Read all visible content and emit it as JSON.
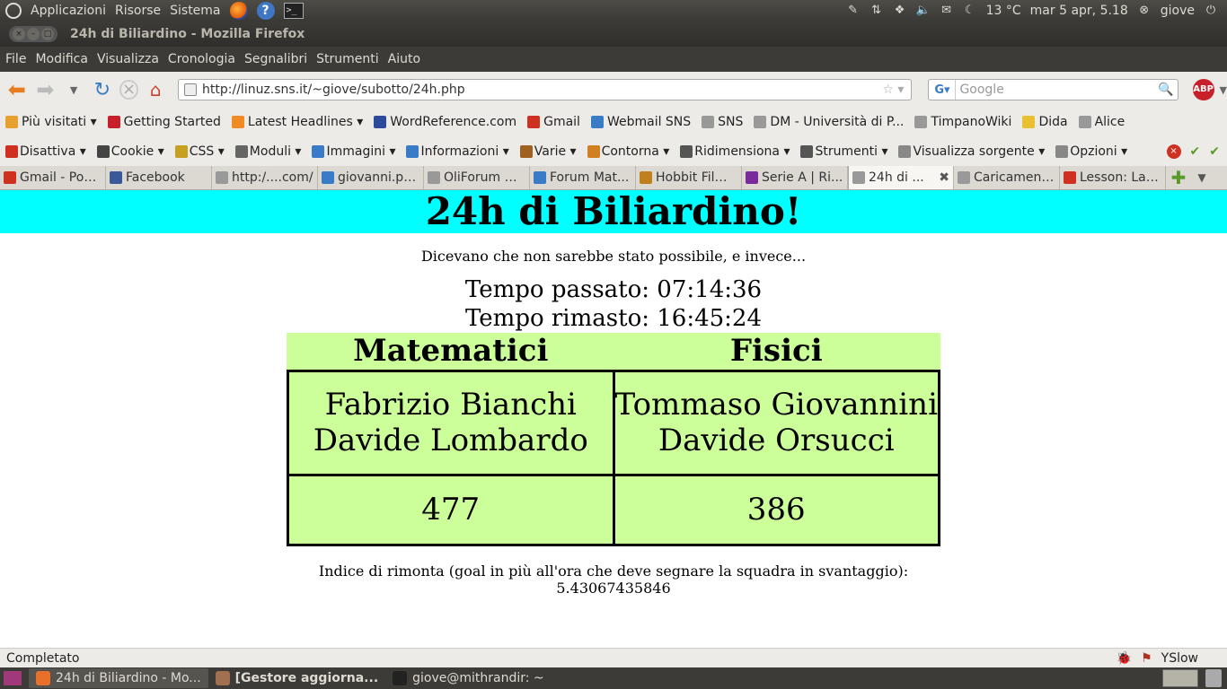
{
  "gnome_panel": {
    "menus": [
      "Applicazioni",
      "Risorse",
      "Sistema"
    ],
    "temperature": "13 °C",
    "datetime": "mar  5 apr, 5.18",
    "user": "giove"
  },
  "window": {
    "title": "24h di Biliardino - Mozilla Firefox"
  },
  "menubar": [
    "File",
    "Modifica",
    "Visualizza",
    "Cronologia",
    "Segnalibri",
    "Strumenti",
    "Aiuto"
  ],
  "navbar": {
    "url": "http://linuz.sns.it/~giove/subotto/24h.php",
    "search_placeholder": "Google",
    "abp_label": "ABP"
  },
  "bookmarks": [
    {
      "label": "Più visitati ▾",
      "color": "#e8a030"
    },
    {
      "label": "Getting Started",
      "color": "#c8202a"
    },
    {
      "label": "Latest Headlines ▾",
      "color": "#f08a24"
    },
    {
      "label": "WordReference.com",
      "color": "#2a4a9b"
    },
    {
      "label": "Gmail",
      "color": "#d03020"
    },
    {
      "label": "Webmail SNS",
      "color": "#3a7bc8"
    },
    {
      "label": "SNS",
      "color": "#999999"
    },
    {
      "label": "DM - Università di P...",
      "color": "#999999"
    },
    {
      "label": "TimpanoWiki",
      "color": "#999999"
    },
    {
      "label": "Dida",
      "color": "#e8c030"
    },
    {
      "label": "Alice",
      "color": "#999999"
    }
  ],
  "webdev": [
    {
      "label": "Disattiva ▾",
      "color": "#d03020"
    },
    {
      "label": "Cookie ▾",
      "color": "#444444"
    },
    {
      "label": "CSS ▾",
      "color": "#c8a020"
    },
    {
      "label": "Moduli ▾",
      "color": "#666666"
    },
    {
      "label": "Immagini ▾",
      "color": "#3a7bc8"
    },
    {
      "label": "Informazioni ▾",
      "color": "#3a7bc8"
    },
    {
      "label": "Varie ▾",
      "color": "#a06020"
    },
    {
      "label": "Contorna ▾",
      "color": "#d08020"
    },
    {
      "label": "Ridimensiona ▾",
      "color": "#555555"
    },
    {
      "label": "Strumenti ▾",
      "color": "#555555"
    },
    {
      "label": "Visualizza sorgente ▾",
      "color": "#888888"
    },
    {
      "label": "Opzioni ▾",
      "color": "#888888"
    }
  ],
  "tabs": [
    {
      "label": "Gmail - Pos...",
      "color": "#d03020"
    },
    {
      "label": "Facebook",
      "color": "#3b5998"
    },
    {
      "label": "http:/....com/",
      "color": "#999999"
    },
    {
      "label": "giovanni.pa...",
      "color": "#3a7bc8"
    },
    {
      "label": "OliForum M...",
      "color": "#999999"
    },
    {
      "label": "Forum Mat...",
      "color": "#3a7bc8"
    },
    {
      "label": "Hobbit Film...",
      "color": "#c08020"
    },
    {
      "label": "Serie A | Ri...",
      "color": "#7a2a9b"
    },
    {
      "label": "24h di ...",
      "color": "#999999",
      "active": true
    },
    {
      "label": "Caricament...",
      "color": "#999999"
    },
    {
      "label": "Lesson: Lan...",
      "color": "#d03020"
    }
  ],
  "page": {
    "header": "24h di Biliardino!",
    "tagline": "Dicevano che non sarebbe stato possibile, e invece...",
    "time_passed": "Tempo passato: 07:14:36",
    "time_left": "Tempo rimasto: 16:45:24",
    "team_left": {
      "name": "Matematici",
      "player1": "Fabrizio Bianchi",
      "player2": "Davide Lombardo",
      "score": "477"
    },
    "team_right": {
      "name": "Fisici",
      "player1": "Tommaso Giovannini",
      "player2": "Davide Orsucci",
      "score": "386"
    },
    "rimonta_label": "Indice di rimonta (goal in più all'ora che deve segnare la squadra in svantaggio):",
    "rimonta_value": "5.43067435846",
    "header_bg": "#00ffff",
    "table_bg": "#ccff99"
  },
  "statusbar": {
    "status": "Completato",
    "yslow": "YSlow"
  },
  "taskbar": [
    {
      "label": "24h di Biliardino - Mo...",
      "color": "#e8702a"
    },
    {
      "label": "[Gestore aggiorna...",
      "color": "#a07050",
      "bold": true
    },
    {
      "label": "giove@mithrandir: ~",
      "color": "#222222"
    }
  ]
}
